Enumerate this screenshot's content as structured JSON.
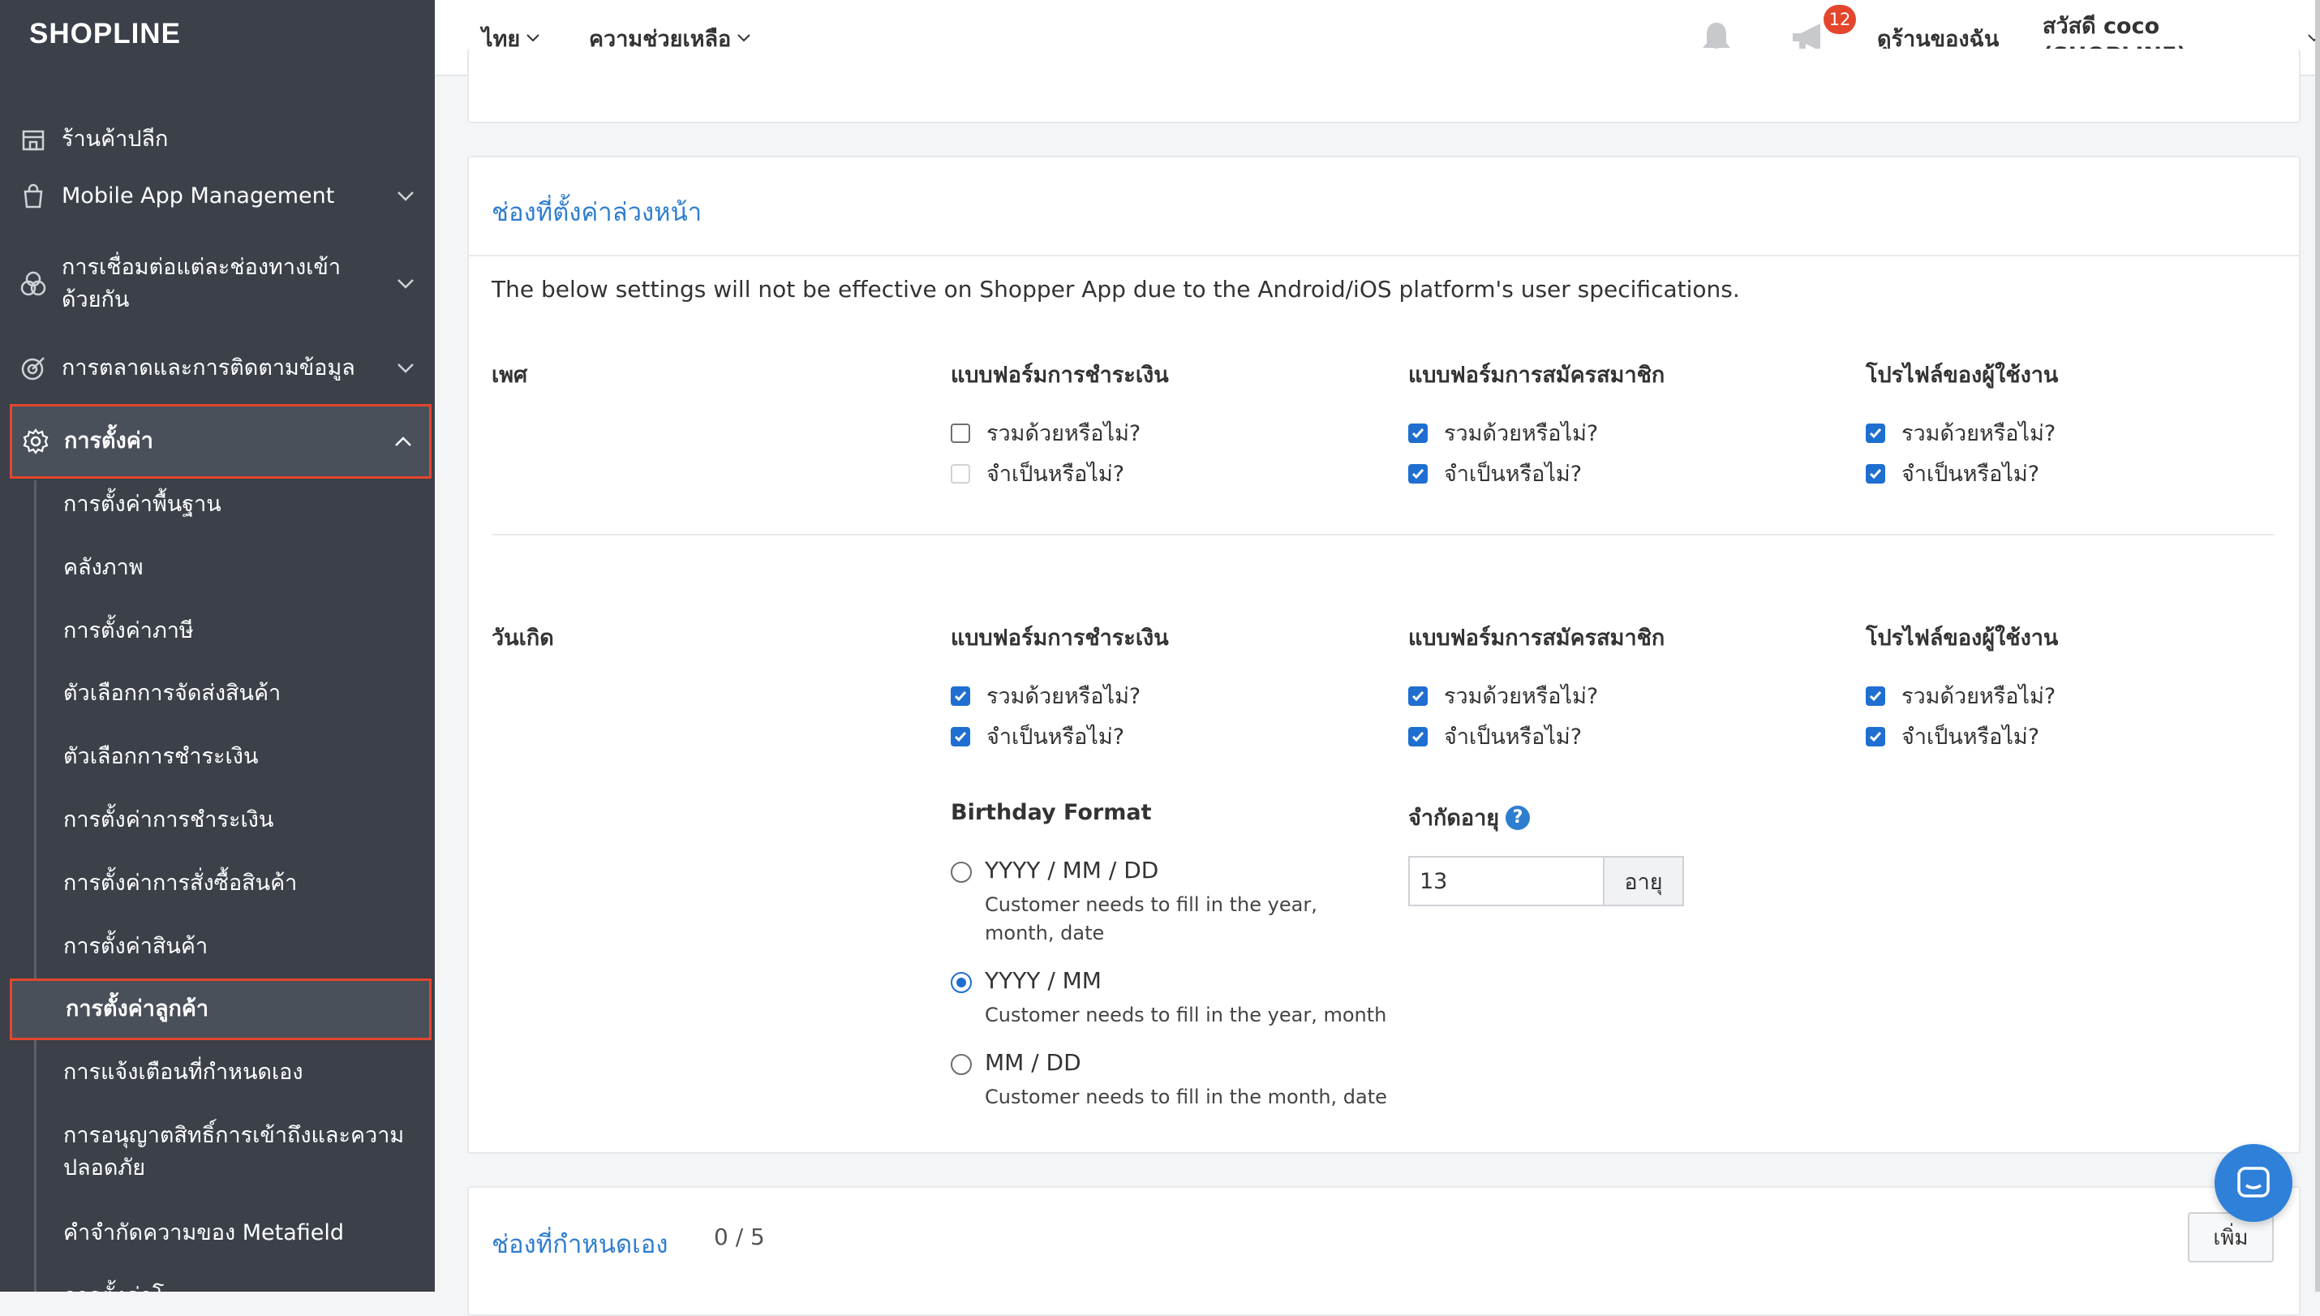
{
  "app": {
    "logo": "SHOPLINE"
  },
  "sidebar": {
    "items": [
      {
        "label": "ร้านค้าปลีก",
        "icon": "store-icon",
        "has_chevron": false
      },
      {
        "label": "Mobile App Management",
        "icon": "shopping-bag-icon",
        "has_chevron": true
      },
      {
        "label": "การเชื่อมต่อแต่ละช่องทางเข้าด้วยกัน",
        "icon": "channels-icon",
        "has_chevron": true
      },
      {
        "label": "การตลาดและการติดตามข้อมูล",
        "icon": "target-icon",
        "has_chevron": true
      },
      {
        "label": "การตั้งค่า",
        "icon": "gear-icon",
        "has_chevron": true,
        "expanded": true,
        "active": true
      }
    ],
    "subitems": [
      {
        "label": "การตั้งค่าพื้นฐาน"
      },
      {
        "label": "คลังภาพ"
      },
      {
        "label": "การตั้งค่าภาษี"
      },
      {
        "label": "ตัวเลือกการจัดส่งสินค้า"
      },
      {
        "label": "ตัวเลือกการชำระเงิน"
      },
      {
        "label": "การตั้งค่าการชำระเงิน"
      },
      {
        "label": "การตั้งค่าการสั่งซื้อสินค้า"
      },
      {
        "label": "การตั้งค่าสินค้า"
      },
      {
        "label": "การตั้งค่าลูกค้า",
        "active": true
      },
      {
        "label": "การแจ้งเตือนที่กำหนดเอง"
      },
      {
        "label": "การอนุญาตสิทธิ์การเข้าถึงและความปลอดภัย"
      },
      {
        "label": "คำจำกัดความของ Metafield"
      },
      {
        "label": "การตั้งค่าโ"
      }
    ]
  },
  "topbar": {
    "language": "ไทย",
    "help": "ความช่วยเหลือ",
    "notification_count": "12",
    "view_store": "ดูร้านของฉัน",
    "greeting": "สวัสดี coco (SHOPLINE)"
  },
  "preset_fields": {
    "title": "ช่องที่ตั้งค่าล่วงหน้า",
    "note": "The below settings will not be effective on Shopper App due to the Android/iOS platform's user specifications.",
    "columns": [
      "แบบฟอร์มการชำระเงิน",
      "แบบฟอร์มการสมัครสมาชิก",
      "โปรไฟล์ของผู้ใช้งาน"
    ],
    "include_label": "รวมด้วยหรือไม่?",
    "required_label": "จำเป็นหรือไม่?",
    "gender": {
      "label": "เพศ",
      "checkout": {
        "include": false,
        "required": false,
        "required_disabled": true
      },
      "signup": {
        "include": true,
        "required": true
      },
      "profile": {
        "include": true,
        "required": true
      }
    },
    "birthday": {
      "label": "วันเกิด",
      "checkout": {
        "include": true,
        "required": true
      },
      "signup": {
        "include": true,
        "required": true
      },
      "profile": {
        "include": true,
        "required": true
      },
      "format_title": "Birthday Format",
      "formats": [
        {
          "label": "YYYY / MM / DD",
          "desc": "Customer needs to fill in the year, month, date",
          "selected": false
        },
        {
          "label": "YYYY / MM",
          "desc": "Customer needs to fill in the year, month",
          "selected": true
        },
        {
          "label": "MM / DD",
          "desc": "Customer needs to fill in the month, date",
          "selected": false
        }
      ],
      "age_limit_title": "จำกัดอายุ",
      "age_limit_value": "13",
      "age_unit": "อายุ"
    }
  },
  "custom_fields": {
    "title": "ช่องที่กำหนดเอง",
    "count": "0 / 5",
    "add_button": "เพิ่ม"
  },
  "colors": {
    "accent": "#2e7ecf",
    "sidebar_bg": "#3b4049",
    "active_border": "#e4462d",
    "checkbox": "#1f6fd1"
  }
}
